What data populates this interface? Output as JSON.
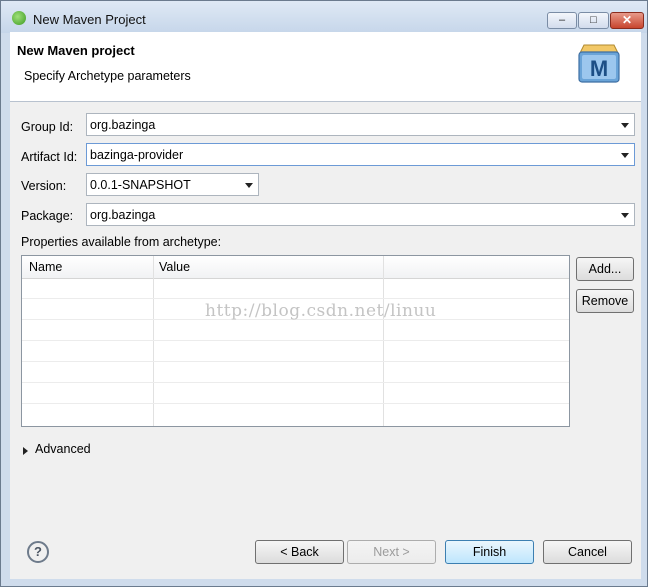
{
  "window": {
    "title": "New Maven Project",
    "min_glyph": "–",
    "max_glyph": "□",
    "close_glyph": "✕"
  },
  "header": {
    "title": "New Maven project",
    "subtitle": "Specify Archetype parameters",
    "logo_letter": "M"
  },
  "form": {
    "group_id": {
      "label": "Group Id:",
      "value": "org.bazinga"
    },
    "artifact_id": {
      "label": "Artifact Id:",
      "value": "bazinga-provider"
    },
    "version": {
      "label": "Version:",
      "value": "0.0.1-SNAPSHOT"
    },
    "package": {
      "label": "Package:",
      "value": "org.bazinga"
    }
  },
  "properties": {
    "label": "Properties available from archetype:",
    "columns": [
      "Name",
      "Value"
    ],
    "rows": [],
    "watermark": "http://blog.csdn.net/linuu",
    "add_label": "Add...",
    "remove_label": "Remove"
  },
  "advanced": {
    "label": "Advanced"
  },
  "footer": {
    "help_glyph": "?",
    "back_label": "< Back",
    "next_label": "Next >",
    "finish_label": "Finish",
    "cancel_label": "Cancel"
  }
}
